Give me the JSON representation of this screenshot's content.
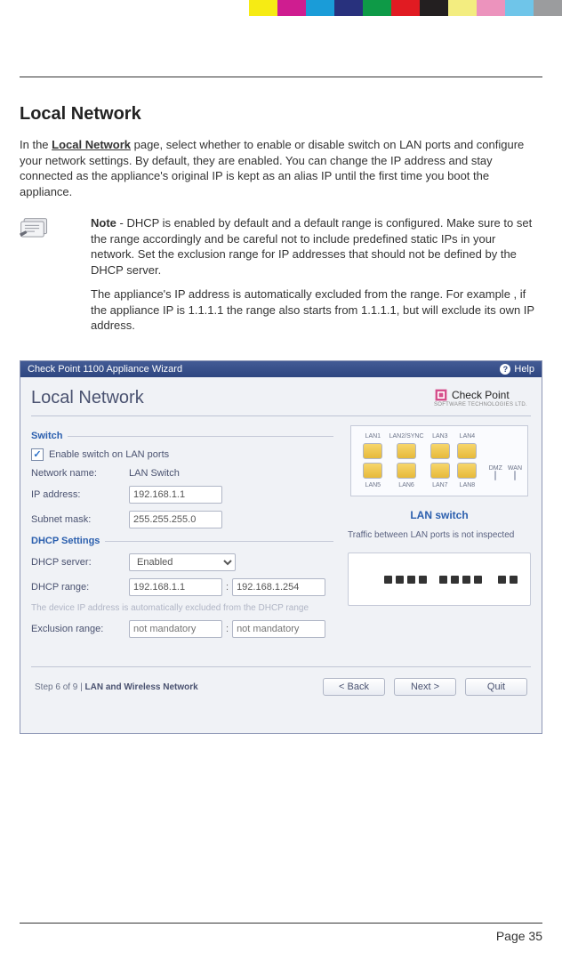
{
  "color_strip": [
    "#f6eb14",
    "#cf1d90",
    "#1a9cd8",
    "#28317d",
    "#0e9a47",
    "#e11b22",
    "#231f20",
    "#f3ed80",
    "#ec93bd",
    "#6fc5e9",
    "#9b9c9e"
  ],
  "title": "Local Network",
  "intro_pre": "In the ",
  "intro_bold": "Local Network",
  "intro_post": " page, select whether to enable or disable switch on LAN ports and configure your network settings. By default, they are enabled. You can change the IP address and stay connected as the appliance's original IP is kept as an alias IP until the first time you boot the appliance.",
  "note_label": "Note",
  "note_p1_post": " - DHCP is enabled by default and a default range is configured. Make sure to set the range accordingly and be careful not to include predefined static IPs in your network. Set the exclusion range for IP addresses that should not be defined by the DHCP server.",
  "note_p2": "The appliance's IP address is automatically excluded from the range. For example , if the appliance IP is 1.1.1.1 the range also starts from 1.1.1.1, but will exclude its own IP address.",
  "wizard": {
    "title": "Check Point 1100 Appliance Wizard",
    "help": "Help",
    "brand_top": "Check Point",
    "brand_sub": "SOFTWARE TECHNOLOGIES LTD.",
    "panel_heading": "Local Network",
    "sections": {
      "switch": "Switch",
      "dhcp": "DHCP Settings"
    },
    "switch": {
      "enable_label": "Enable switch on LAN ports",
      "enable_checked": true,
      "network_name_label": "Network name:",
      "network_name_value": "LAN Switch",
      "ip_label": "IP address:",
      "ip_value": "192.168.1.1",
      "mask_label": "Subnet mask:",
      "mask_value": "255.255.255.0"
    },
    "dhcp": {
      "server_label": "DHCP server:",
      "server_value": "Enabled",
      "range_label": "DHCP range:",
      "range_from": "192.168.1.1",
      "range_to": "192.168.1.254",
      "auto_exclude_note": "The device IP address is automatically excluded from the DHCP range",
      "exclusion_label": "Exclusion range:",
      "exclusion_placeholder": "not mandatory"
    },
    "side": {
      "top_labels": [
        "LAN1",
        "LAN2/SYNC",
        "LAN3",
        "LAN4"
      ],
      "bot_labels": [
        "LAN5",
        "LAN6",
        "LAN7",
        "LAN8"
      ],
      "extra_labels": [
        "DMZ",
        "WAN"
      ],
      "lan_switch": "LAN switch",
      "traffic_note": "Traffic between LAN ports is not inspected"
    },
    "footer": {
      "step_text_pre": "Step 6 of 9 |  ",
      "step_text_bold": "LAN and Wireless Network",
      "back": "<  Back",
      "next": "Next  >",
      "quit": "Quit"
    }
  },
  "page_number": "Page 35"
}
